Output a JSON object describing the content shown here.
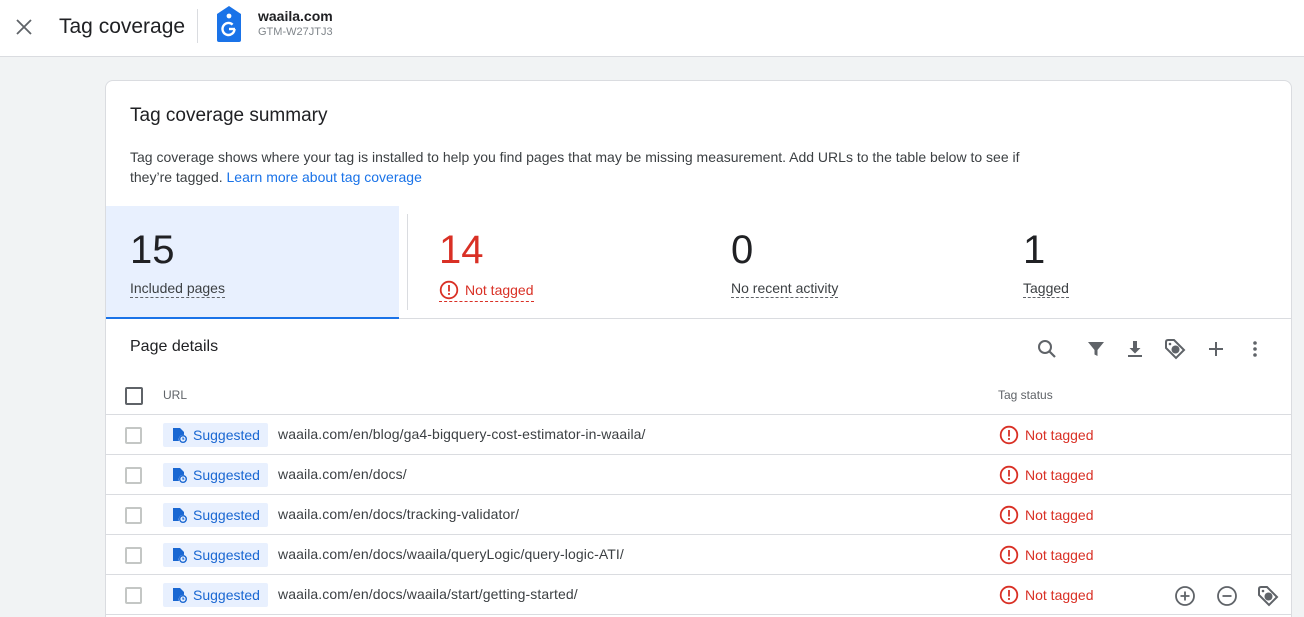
{
  "header": {
    "title": "Tag coverage",
    "site_name": "waaila.com",
    "container_id": "GTM-W27JTJ3"
  },
  "summary": {
    "title": "Tag coverage summary",
    "description": "Tag coverage shows where your tag is installed to help you find pages that may be missing measurement. Add URLs to the table below to see if they’re tagged.",
    "learn_more": "Learn more about tag coverage"
  },
  "stats": [
    {
      "value": "15",
      "label": "Included pages"
    },
    {
      "value": "14",
      "label": "Not tagged"
    },
    {
      "value": "0",
      "label": "No recent activity"
    },
    {
      "value": "1",
      "label": "Tagged"
    }
  ],
  "details": {
    "title": "Page details",
    "col_url": "URL",
    "col_status": "Tag status"
  },
  "rows": [
    {
      "chip": "Suggested",
      "url": "waaila.com/en/blog/ga4-bigquery-cost-estimator-in-waaila/",
      "status": "Not tagged"
    },
    {
      "chip": "Suggested",
      "url": "waaila.com/en/docs/",
      "status": "Not tagged"
    },
    {
      "chip": "Suggested",
      "url": "waaila.com/en/docs/tracking-validator/",
      "status": "Not tagged"
    },
    {
      "chip": "Suggested",
      "url": "waaila.com/en/docs/waaila/queryLogic/query-logic-ATI/",
      "status": "Not tagged"
    },
    {
      "chip": "Suggested",
      "url": "waaila.com/en/docs/waaila/start/getting-started/",
      "status": "Not tagged"
    }
  ],
  "colors": {
    "accent": "#1a73e8",
    "error": "#d93025",
    "active_bg": "#e8f0fe"
  }
}
